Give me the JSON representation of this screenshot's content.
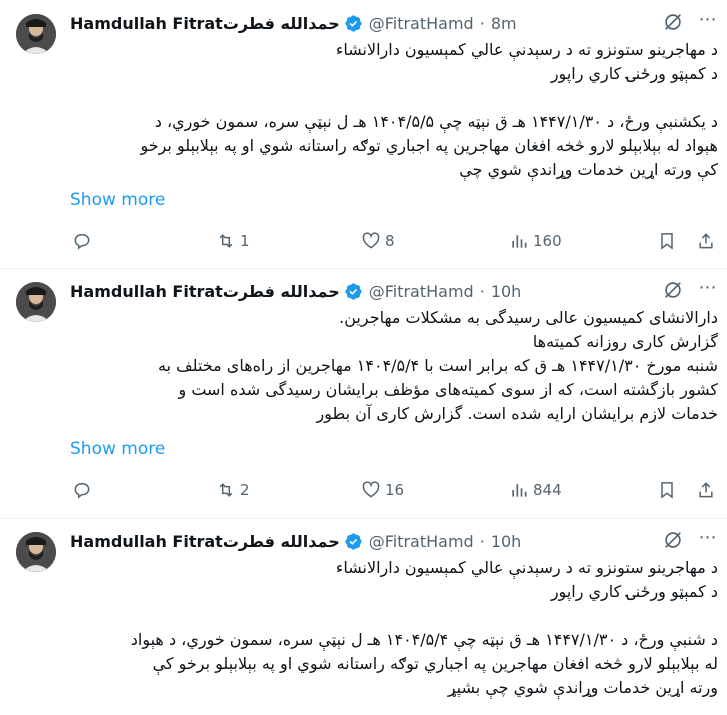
{
  "tweets": [
    {
      "name": "Hamdullah Fitrat",
      "name_rtl": "حمدالله فطرت",
      "handle": "@FitratHamd",
      "time": "8m",
      "lines": [
        "د مهاجرینو ستونزو ته د رسېدنې عالي کمېسیون دارالانشاء",
        "د کمېټو ورځنۍ کاري راپور",
        "",
        "د یکشنبې ورځ، د ۱۴۴۷/۱/۳۰ هـ ق نېټه چې ۱۴۰۴/۵/۵ هـ ل نېټې سره، سمون خوري، د",
        "هېواد له بېلابېلو لارو څخه افغان مهاجرین په اجباري توګه راستانه شوي او په بېلابېلو برخو",
        "کې ورته اړین خدمات وړاندې شوي چې"
      ],
      "show_more": "Show more",
      "replies": "",
      "reposts": "1",
      "likes": "8",
      "views": "160"
    },
    {
      "name": "Hamdullah Fitrat",
      "name_rtl": "حمدالله فطرت",
      "handle": "@FitratHamd",
      "time": "10h",
      "lines": [
        "دارالانشای کمیسیون عالی رسیدگی به مشکلات مهاجرین.",
        "گزارش کاری روزانه کمیته‌ها",
        "شنبه مورخ ۱۴۴۷/۱/۳۰ هـ ق که برابر است با ۱۴۰۴/۵/۴ مهاجرین از راه‌های مختلف به",
        "کشور بازگشته است، که از سوی کمیته‌های مؤظف برایشان رسیدگی شده است و",
        "خدمات لازم برایشان ارایه شده است. گزارش کاری آن بطور"
      ],
      "show_more": "Show more",
      "replies": "",
      "reposts": "2",
      "likes": "16",
      "views": "844"
    },
    {
      "name": "Hamdullah Fitrat",
      "name_rtl": "حمدالله فطرت",
      "handle": "@FitratHamd",
      "time": "10h",
      "lines": [
        "د مهاجرینو ستونزو ته د رسېدنې عالي کمېسیون دارالانشاء",
        "د کمېټو ورځنۍ کاري راپور",
        "",
        "د شنبې ورځ، د ۱۴۴۷/۱/۳۰ هـ ق نېټه چې ۱۴۰۴/۵/۴ هـ ل نېټې سره، سمون خوري، د هېواد",
        "له بېلابېلو لارو څخه افغان مهاجرین په اجباري توګه راستانه شوي او په بېلابېلو برخو کې",
        "ورته اړین خدمات وړاندې شوي چې بشپړ"
      ],
      "show_more": "",
      "replies": "",
      "reposts": "",
      "likes": "",
      "views": ""
    }
  ],
  "colors": {
    "accent": "#1d9bf0",
    "muted": "#536471",
    "text": "#0f1419"
  },
  "icons": [
    "reply-icon",
    "repost-icon",
    "like-icon",
    "views-icon",
    "bookmark-icon",
    "share-icon",
    "verified-icon",
    "grok-icon",
    "more-icon"
  ]
}
